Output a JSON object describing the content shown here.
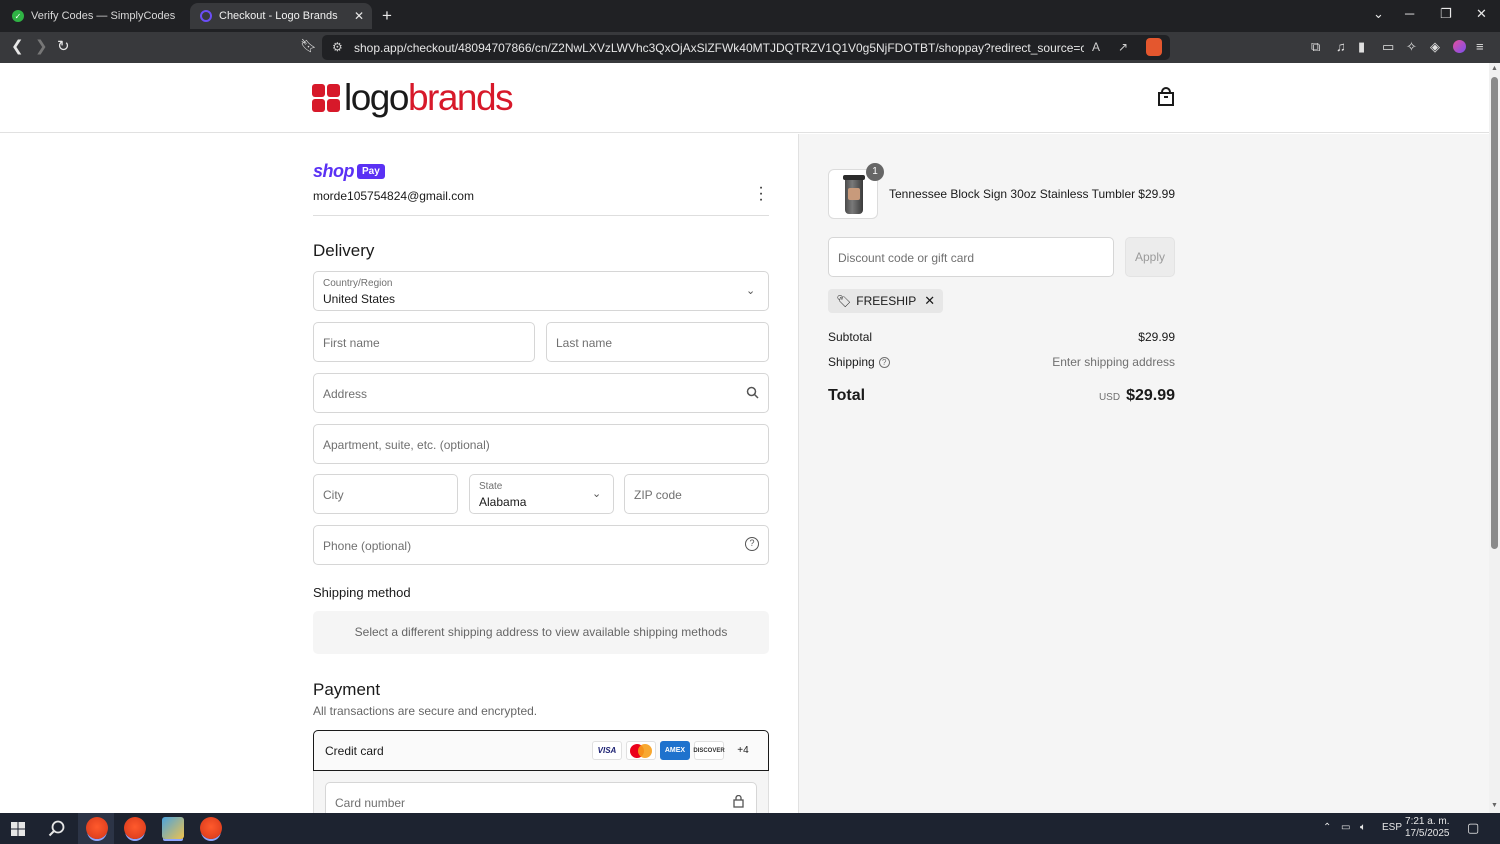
{
  "browser": {
    "tabs": [
      {
        "title": "Verify Codes — SimplyCodes",
        "active": false
      },
      {
        "title": "Checkout - Logo Brands",
        "active": true
      }
    ],
    "url": "shop.app/checkout/48094707866/cn/Z2NwLXVzLWVhc3QxOjAxSlZFWk40MTJDQTRZV1Q1V0g5NjFDOTBT/shoppay?redirect_source=checkout_univer..."
  },
  "store": {
    "logo_text_dark": "logo",
    "logo_text_red": "brands"
  },
  "account": {
    "shop_label": "shop",
    "pay_label": "Pay",
    "email": "morde105754824@gmail.com"
  },
  "delivery": {
    "heading": "Delivery",
    "country_label": "Country/Region",
    "country_value": "United States",
    "first_name_placeholder": "First name",
    "last_name_placeholder": "Last name",
    "address_placeholder": "Address",
    "apartment_placeholder": "Apartment, suite, etc. (optional)",
    "city_placeholder": "City",
    "state_label": "State",
    "state_value": "Alabama",
    "zip_placeholder": "ZIP code",
    "phone_placeholder": "Phone (optional)"
  },
  "shipping_method": {
    "heading": "Shipping method",
    "message": "Select a different shipping address to view available shipping methods"
  },
  "payment": {
    "heading": "Payment",
    "subtext": "All transactions are secure and encrypted.",
    "method_label": "Credit card",
    "card_brands": [
      "VISA",
      "AMEX",
      "DISCOVER"
    ],
    "more_label": "+4",
    "card_number_placeholder": "Card number"
  },
  "summary": {
    "item_name": "Tennessee Block Sign 30oz Stainless Tumbler",
    "item_price": "$29.99",
    "item_quantity": "1",
    "discount_placeholder": "Discount code or gift card",
    "apply_label": "Apply",
    "discount_tag": "FREESHIP",
    "subtotal_label": "Subtotal",
    "subtotal_value": "$29.99",
    "shipping_label": "Shipping",
    "shipping_value": "Enter shipping address",
    "total_label": "Total",
    "currency": "USD",
    "total_value": "$29.99"
  },
  "taskbar": {
    "language": "ESP",
    "time": "7:21 a. m.",
    "date": "17/5/2025"
  },
  "colors": {
    "brand_red": "#d7192a",
    "shop_pay_purple": "#5a31f4"
  }
}
